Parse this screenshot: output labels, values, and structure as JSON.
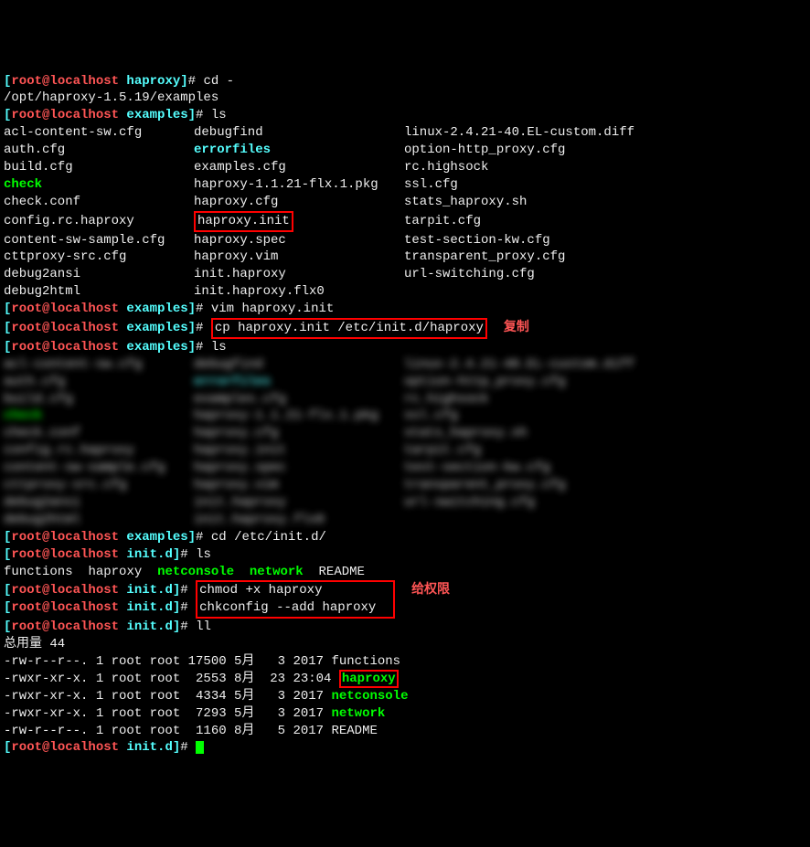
{
  "prompts": {
    "haproxy": "[root@localhost haproxy]# ",
    "examples": "[root@localhost examples]# ",
    "initd": "[root@localhost init.d]# "
  },
  "cmds": {
    "cd_dash": "cd -",
    "cd_path_echo": "/opt/haproxy-1.5.19/examples",
    "ls": "ls",
    "vim": "vim haproxy.init",
    "cp": "cp haproxy.init /etc/init.d/haproxy",
    "cd_initd": "cd /etc/init.d/",
    "chmod": "chmod +x haproxy",
    "chkconfig": "chkconfig --add haproxy",
    "ll": "ll"
  },
  "annotations": {
    "copy": "复制",
    "perm": "给权限"
  },
  "ls_examples": [
    {
      "a": "acl-content-sw.cfg",
      "b": "debugfind",
      "c": "linux-2.4.21-40.EL-custom.diff"
    },
    {
      "a": "auth.cfg",
      "b": "errorfiles",
      "b_cls": "cyan",
      "c": "option-http_proxy.cfg"
    },
    {
      "a": "build.cfg",
      "b": "examples.cfg",
      "c": "rc.highsock"
    },
    {
      "a": "check",
      "a_cls": "green",
      "b": "haproxy-1.1.21-flx.1.pkg",
      "c": "ssl.cfg"
    },
    {
      "a": "check.conf",
      "b": "haproxy.cfg",
      "c": "stats_haproxy.sh"
    },
    {
      "a": "config.rc.haproxy",
      "b": "haproxy.init",
      "b_box": true,
      "c": "tarpit.cfg"
    },
    {
      "a": "content-sw-sample.cfg",
      "b": "haproxy.spec",
      "c": "test-section-kw.cfg"
    },
    {
      "a": "cttproxy-src.cfg",
      "b": "haproxy.vim",
      "c": "transparent_proxy.cfg"
    },
    {
      "a": "debug2ansi",
      "b": "init.haproxy",
      "c": "url-switching.cfg"
    },
    {
      "a": "debug2html",
      "b": "init.haproxy.flx0",
      "c": ""
    }
  ],
  "blur_rows": [
    {
      "a": "acl-content-sw.cfg",
      "b": "debugfind",
      "c": "linux-2.4.21-40.EL-custom.diff"
    },
    {
      "a": "auth.cfg",
      "b": "errorfiles",
      "b_cls": "cyan",
      "c": "option-http_proxy.cfg"
    },
    {
      "a": "build.cfg",
      "b": "examples.cfg",
      "c": "rc.highsock"
    },
    {
      "a": "check",
      "a_cls": "green",
      "b": "haproxy-1.1.21-flx.1.pkg",
      "c": "ssl.cfg"
    },
    {
      "a": "check.conf",
      "b": "haproxy.cfg",
      "c": "stats_haproxy.sh"
    },
    {
      "a": "config.rc.haproxy",
      "b": "haproxy.init",
      "c": "tarpit.cfg"
    },
    {
      "a": "content-sw-sample.cfg",
      "b": "haproxy.spec",
      "c": "test-section-kw.cfg"
    },
    {
      "a": "cttproxy-src.cfg",
      "b": "haproxy.vim",
      "c": "transparent_proxy.cfg"
    },
    {
      "a": "debug2ansi",
      "b": "init.haproxy",
      "c": "url-switching.cfg"
    },
    {
      "a": "debug2html",
      "b": "init.haproxy.flx0",
      "c": ""
    }
  ],
  "ls_initd": {
    "items": [
      "functions",
      "haproxy",
      "netconsole",
      "network",
      "README"
    ],
    "classes": [
      "white",
      "white",
      "green",
      "green",
      "white"
    ]
  },
  "ll": {
    "total": "总用量 44",
    "rows": [
      {
        "perm": "-rw-r--r--.",
        "links": "1",
        "owner": "root",
        "group": "root",
        "size": "17500",
        "mon": "5月",
        "day": " 3",
        "time": "2017",
        "name": "functions",
        "name_cls": "white"
      },
      {
        "perm": "-rwxr-xr-x.",
        "links": "1",
        "owner": "root",
        "group": "root",
        "size": " 2553",
        "mon": "8月",
        "day": "23",
        "time": "23:04",
        "name": "haproxy",
        "name_cls": "green",
        "box": true
      },
      {
        "perm": "-rwxr-xr-x.",
        "links": "1",
        "owner": "root",
        "group": "root",
        "size": " 4334",
        "mon": "5月",
        "day": " 3",
        "time": "2017",
        "name": "netconsole",
        "name_cls": "green"
      },
      {
        "perm": "-rwxr-xr-x.",
        "links": "1",
        "owner": "root",
        "group": "root",
        "size": " 7293",
        "mon": "5月",
        "day": " 3",
        "time": "2017",
        "name": "network",
        "name_cls": "green"
      },
      {
        "perm": "-rw-r--r--.",
        "links": "1",
        "owner": "root",
        "group": "root",
        "size": " 1160",
        "mon": "8月",
        "day": " 5",
        "time": "2017",
        "name": "README",
        "name_cls": "white"
      }
    ]
  }
}
